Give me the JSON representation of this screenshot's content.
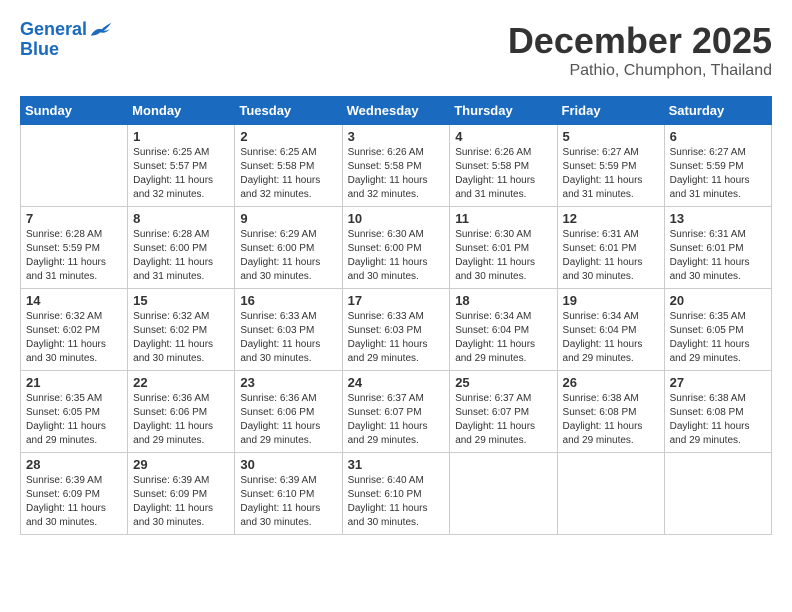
{
  "header": {
    "logo_line1": "General",
    "logo_line2": "Blue",
    "month": "December 2025",
    "location": "Pathio, Chumphon, Thailand"
  },
  "weekdays": [
    "Sunday",
    "Monday",
    "Tuesday",
    "Wednesday",
    "Thursday",
    "Friday",
    "Saturday"
  ],
  "weeks": [
    [
      {
        "day": "",
        "info": ""
      },
      {
        "day": "1",
        "info": "Sunrise: 6:25 AM\nSunset: 5:57 PM\nDaylight: 11 hours\nand 32 minutes."
      },
      {
        "day": "2",
        "info": "Sunrise: 6:25 AM\nSunset: 5:58 PM\nDaylight: 11 hours\nand 32 minutes."
      },
      {
        "day": "3",
        "info": "Sunrise: 6:26 AM\nSunset: 5:58 PM\nDaylight: 11 hours\nand 32 minutes."
      },
      {
        "day": "4",
        "info": "Sunrise: 6:26 AM\nSunset: 5:58 PM\nDaylight: 11 hours\nand 31 minutes."
      },
      {
        "day": "5",
        "info": "Sunrise: 6:27 AM\nSunset: 5:59 PM\nDaylight: 11 hours\nand 31 minutes."
      },
      {
        "day": "6",
        "info": "Sunrise: 6:27 AM\nSunset: 5:59 PM\nDaylight: 11 hours\nand 31 minutes."
      }
    ],
    [
      {
        "day": "7",
        "info": "Sunrise: 6:28 AM\nSunset: 5:59 PM\nDaylight: 11 hours\nand 31 minutes."
      },
      {
        "day": "8",
        "info": "Sunrise: 6:28 AM\nSunset: 6:00 PM\nDaylight: 11 hours\nand 31 minutes."
      },
      {
        "day": "9",
        "info": "Sunrise: 6:29 AM\nSunset: 6:00 PM\nDaylight: 11 hours\nand 30 minutes."
      },
      {
        "day": "10",
        "info": "Sunrise: 6:30 AM\nSunset: 6:00 PM\nDaylight: 11 hours\nand 30 minutes."
      },
      {
        "day": "11",
        "info": "Sunrise: 6:30 AM\nSunset: 6:01 PM\nDaylight: 11 hours\nand 30 minutes."
      },
      {
        "day": "12",
        "info": "Sunrise: 6:31 AM\nSunset: 6:01 PM\nDaylight: 11 hours\nand 30 minutes."
      },
      {
        "day": "13",
        "info": "Sunrise: 6:31 AM\nSunset: 6:01 PM\nDaylight: 11 hours\nand 30 minutes."
      }
    ],
    [
      {
        "day": "14",
        "info": "Sunrise: 6:32 AM\nSunset: 6:02 PM\nDaylight: 11 hours\nand 30 minutes."
      },
      {
        "day": "15",
        "info": "Sunrise: 6:32 AM\nSunset: 6:02 PM\nDaylight: 11 hours\nand 30 minutes."
      },
      {
        "day": "16",
        "info": "Sunrise: 6:33 AM\nSunset: 6:03 PM\nDaylight: 11 hours\nand 30 minutes."
      },
      {
        "day": "17",
        "info": "Sunrise: 6:33 AM\nSunset: 6:03 PM\nDaylight: 11 hours\nand 29 minutes."
      },
      {
        "day": "18",
        "info": "Sunrise: 6:34 AM\nSunset: 6:04 PM\nDaylight: 11 hours\nand 29 minutes."
      },
      {
        "day": "19",
        "info": "Sunrise: 6:34 AM\nSunset: 6:04 PM\nDaylight: 11 hours\nand 29 minutes."
      },
      {
        "day": "20",
        "info": "Sunrise: 6:35 AM\nSunset: 6:05 PM\nDaylight: 11 hours\nand 29 minutes."
      }
    ],
    [
      {
        "day": "21",
        "info": "Sunrise: 6:35 AM\nSunset: 6:05 PM\nDaylight: 11 hours\nand 29 minutes."
      },
      {
        "day": "22",
        "info": "Sunrise: 6:36 AM\nSunset: 6:06 PM\nDaylight: 11 hours\nand 29 minutes."
      },
      {
        "day": "23",
        "info": "Sunrise: 6:36 AM\nSunset: 6:06 PM\nDaylight: 11 hours\nand 29 minutes."
      },
      {
        "day": "24",
        "info": "Sunrise: 6:37 AM\nSunset: 6:07 PM\nDaylight: 11 hours\nand 29 minutes."
      },
      {
        "day": "25",
        "info": "Sunrise: 6:37 AM\nSunset: 6:07 PM\nDaylight: 11 hours\nand 29 minutes."
      },
      {
        "day": "26",
        "info": "Sunrise: 6:38 AM\nSunset: 6:08 PM\nDaylight: 11 hours\nand 29 minutes."
      },
      {
        "day": "27",
        "info": "Sunrise: 6:38 AM\nSunset: 6:08 PM\nDaylight: 11 hours\nand 29 minutes."
      }
    ],
    [
      {
        "day": "28",
        "info": "Sunrise: 6:39 AM\nSunset: 6:09 PM\nDaylight: 11 hours\nand 30 minutes."
      },
      {
        "day": "29",
        "info": "Sunrise: 6:39 AM\nSunset: 6:09 PM\nDaylight: 11 hours\nand 30 minutes."
      },
      {
        "day": "30",
        "info": "Sunrise: 6:39 AM\nSunset: 6:10 PM\nDaylight: 11 hours\nand 30 minutes."
      },
      {
        "day": "31",
        "info": "Sunrise: 6:40 AM\nSunset: 6:10 PM\nDaylight: 11 hours\nand 30 minutes."
      },
      {
        "day": "",
        "info": ""
      },
      {
        "day": "",
        "info": ""
      },
      {
        "day": "",
        "info": ""
      }
    ]
  ]
}
